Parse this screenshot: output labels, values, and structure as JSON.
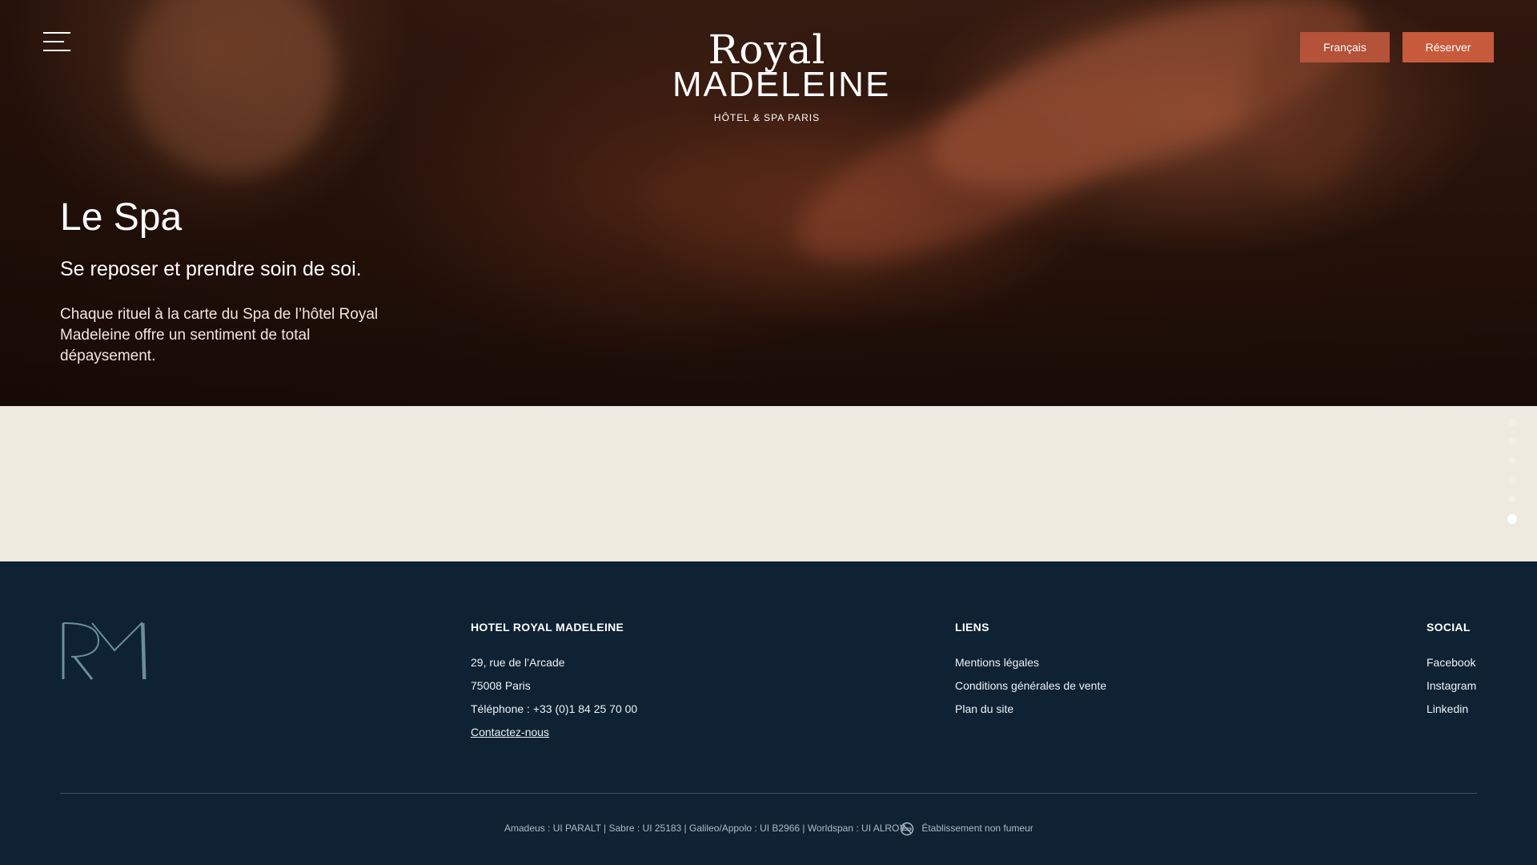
{
  "header": {
    "menu_icon": "hamburger-menu-icon",
    "logo": {
      "line1": "Royal",
      "line2": "MADELEINE",
      "tagline": "HÔTEL & SPA PARIS"
    },
    "language_button": "Français",
    "book_button": "Réserver"
  },
  "hero": {
    "title": "Le Spa",
    "subtitle": "Se reposer et prendre soin de soi.",
    "description": "Chaque rituel à la carte du Spa de l’hôtel Royal Madeleine offre un sentiment de total dépaysement."
  },
  "pagination": {
    "total": 6,
    "active_index": 5
  },
  "footer": {
    "hotel": {
      "heading": "HOTEL ROYAL MADELEINE",
      "address1": "29, rue de l’Arcade",
      "address2": "75008 Paris",
      "phone": "Téléphone : +33 (0)1 84 25 70 00",
      "contact": "Contactez-nous"
    },
    "links": {
      "heading": "LIENS",
      "items": [
        "Mentions légales",
        "Conditions générales de vente",
        "Plan du site"
      ]
    },
    "social": {
      "heading": "SOCIAL",
      "items": [
        "Facebook",
        "Instagram",
        "Linkedin"
      ]
    },
    "gds_codes": "Amadeus : UI PARALT | Sabre : UI 25183 | Galileo/Appolo : UI B2966  | Worldspan : UI ALROY",
    "non_smoking": "Établissement non fumeur"
  },
  "colors": {
    "footer_bg": "#0e2233",
    "cream_bg": "#efeadf",
    "accent": "#c85a3c"
  }
}
